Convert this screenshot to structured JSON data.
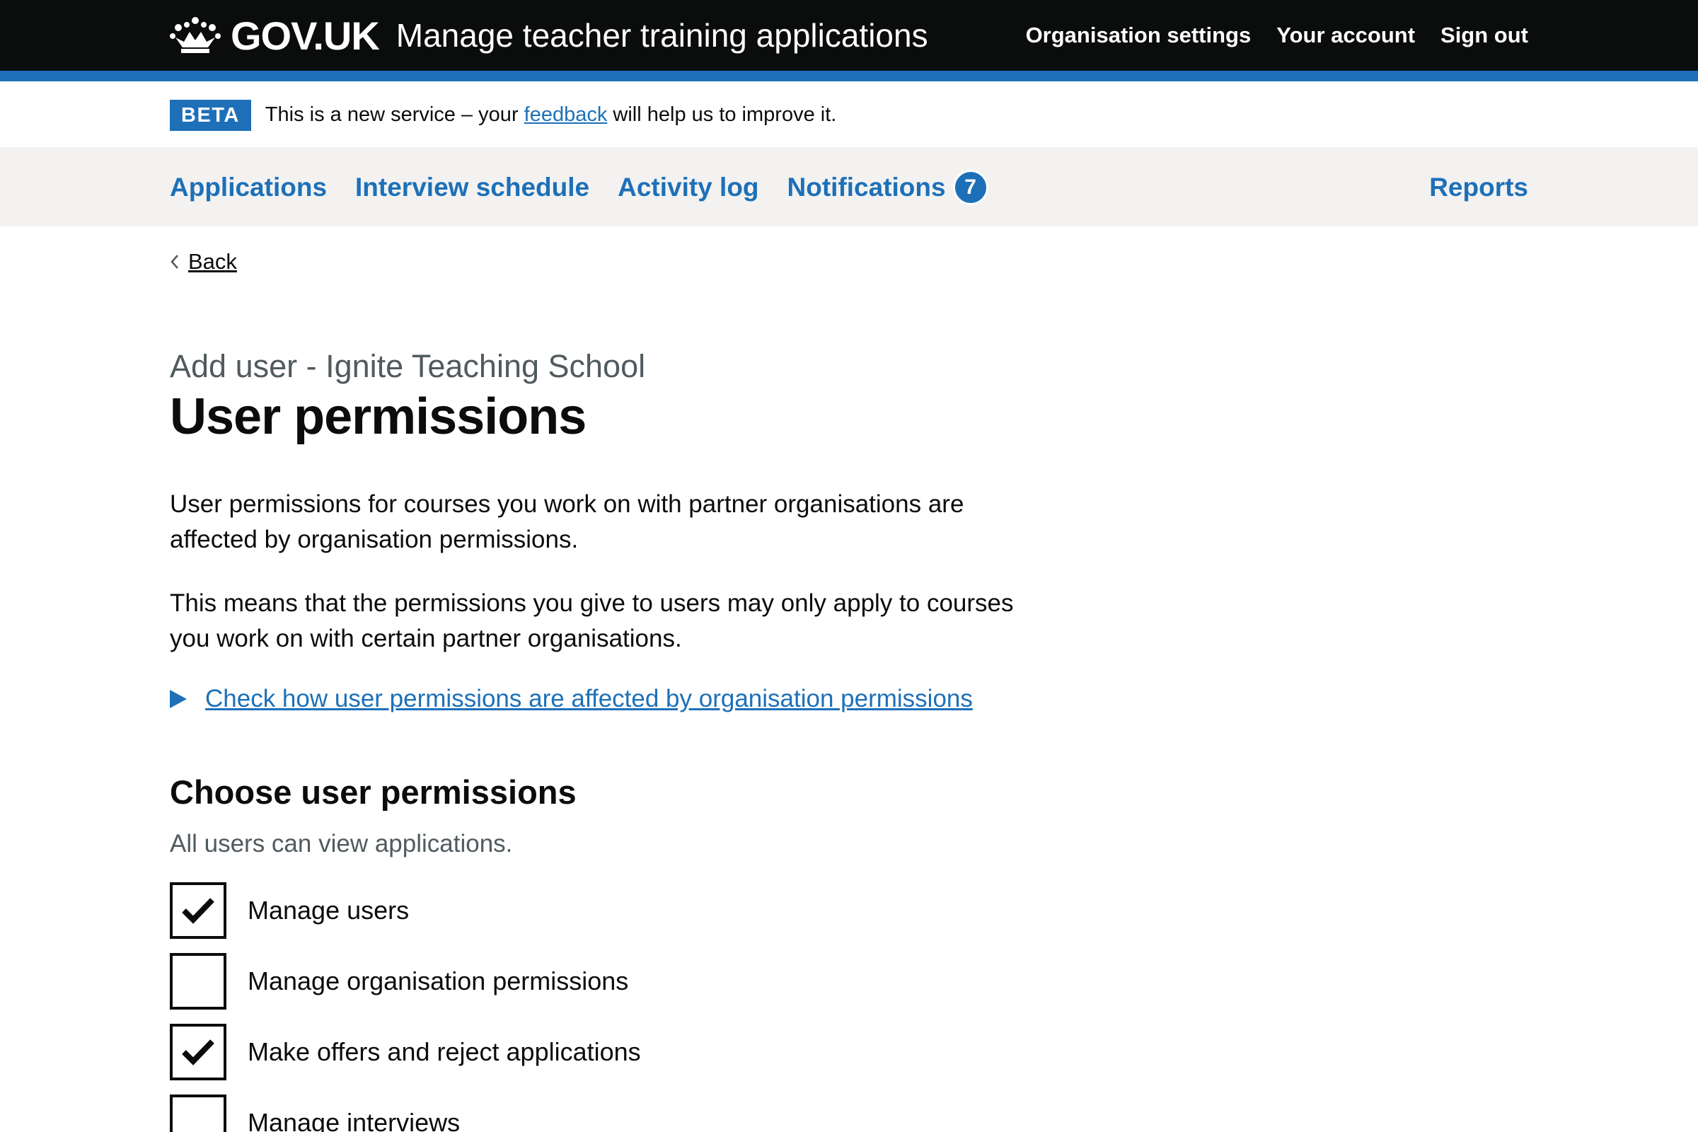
{
  "header": {
    "logo_text": "GOV.UK",
    "service_name": "Manage teacher training applications",
    "nav": [
      "Organisation settings",
      "Your account",
      "Sign out"
    ]
  },
  "phase_banner": {
    "tag": "BETA",
    "text_before": "This is a new service – your ",
    "link": "feedback",
    "text_after": " will help us to improve it."
  },
  "primary_nav": {
    "items": [
      "Applications",
      "Interview schedule",
      "Activity log",
      "Notifications"
    ],
    "notifications_count": "7",
    "reports": "Reports"
  },
  "back_link": "Back",
  "main": {
    "caption": "Add user - Ignite Teaching School",
    "title": "User permissions",
    "paragraph_1": "User permissions for courses you work on with partner organisations are affected by organisation permissions.",
    "paragraph_2": "This means that the permissions you give to users may only apply to courses you work on with certain partner organisations.",
    "details_summary": "Check how user permissions are affected by organisation permissions",
    "fieldset_legend": "Choose user permissions",
    "hint": "All users can view applications.",
    "checkboxes": [
      {
        "label": "Manage users",
        "checked": true
      },
      {
        "label": "Manage organisation permissions",
        "checked": false
      },
      {
        "label": "Make offers and reject applications",
        "checked": true
      },
      {
        "label": "Manage interviews",
        "checked": false
      }
    ]
  },
  "colors": {
    "header_bg": "#0b0c0c",
    "brand_blue": "#1d70b8",
    "nav_bg": "#f3f2f1",
    "secondary_text": "#505a5f"
  }
}
